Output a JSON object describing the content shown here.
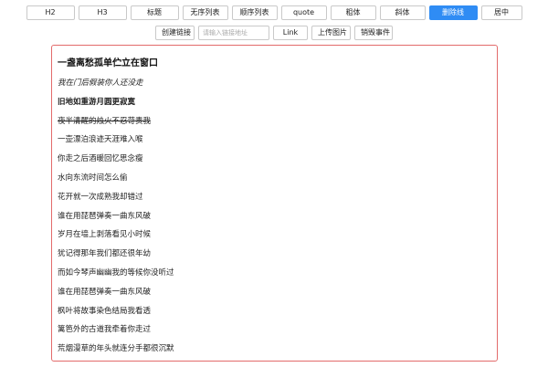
{
  "toolbar": {
    "row1": [
      {
        "key": "h2",
        "label": "H2",
        "active": false
      },
      {
        "key": "h3",
        "label": "H3",
        "active": false
      },
      {
        "key": "title",
        "label": "标题",
        "active": false
      },
      {
        "key": "ul",
        "label": "无序列表",
        "active": false
      },
      {
        "key": "ol",
        "label": "顺序列表",
        "active": false
      },
      {
        "key": "quote",
        "label": "quote",
        "active": false
      },
      {
        "key": "bold",
        "label": "粗体",
        "active": false
      },
      {
        "key": "italic",
        "label": "斜体",
        "active": false
      },
      {
        "key": "strike",
        "label": "删除线",
        "active": true
      },
      {
        "key": "center",
        "label": "居中",
        "active": false
      }
    ],
    "create_link_label": "创建链接",
    "link_input_placeholder": "请输入链接地址",
    "link_label": "Link",
    "upload_image_label": "上传图片",
    "destroy_label": "销毁事件"
  },
  "colors": {
    "active_button_bg": "#2f8cf4",
    "editor_border": "#e36b6b"
  },
  "editor": {
    "heading": "一盏离愁孤单伫立在窗口",
    "italic_line": "我在门后假装你人还没走",
    "bold_line": "旧地如重游月圆更寂寞",
    "strike_line": "夜半清醒的烛火不忍苛责我",
    "lines": [
      "一壶漂泊浪迹天涯难入喉",
      "你走之后酒暖回忆思念瘦",
      "水向东流时间怎么偷",
      "花开就一次成熟我却错过",
      "谁在用琵琶弹奏一曲东风破",
      "岁月在墙上剥落看见小时候",
      "犹记得那年我们都还很年幼",
      "而如今琴声幽幽我的等候你没听过",
      "谁在用琵琶弹奏一曲东风破",
      "枫叶将故事染色结局我看透",
      "篱笆外的古道我牵着你走过",
      "荒烟漫草的年头就连分手都很沉默"
    ]
  }
}
